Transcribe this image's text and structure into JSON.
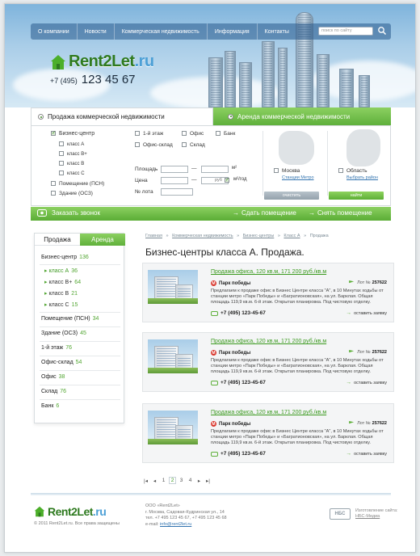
{
  "nav": {
    "items": [
      "О компании",
      "Новости",
      "Коммерческая недвижимость",
      "Информация",
      "Контакты"
    ],
    "search_placeholder": "поиск по сайту"
  },
  "brand": {
    "name_main": "Rent2Let",
    "name_tld": ".ru",
    "phone_code": "+7 (495)",
    "phone_number": "123 45 67"
  },
  "search_panel": {
    "tab_commercial": "Продажа коммерческой недвижимости",
    "tab_rent": "Аренда коммерческой недвижимости",
    "types": {
      "business_center": "Бизнес-центр",
      "class_a": "класс А",
      "class_b_plus": "класс В+",
      "class_b": "класс В",
      "class_c": "класс С",
      "premises": "Помещение (ПСН)",
      "building": "Здание (ОСЗ)"
    },
    "options": {
      "first_floor": "1-й этаж",
      "office": "Офис",
      "bank": "Банк",
      "office_warehouse": "Офис-склад",
      "warehouse": "Склад"
    },
    "area_label": "Площадь",
    "area_unit": "м²",
    "price_label": "Цена",
    "price_currency": "руб",
    "price_per": "м²/год",
    "lot_label": "№ лота",
    "dash": "—",
    "moscow": "Москва",
    "metro_stations": "Станции Метро",
    "region": "Область",
    "choose_region": "Выбрать район",
    "clear_button": "очистить",
    "find_button": "найти"
  },
  "actions": {
    "order_call": "Заказать звонок",
    "lease_out": "Сдать помещение",
    "rent_in": "Снять помещение"
  },
  "sidebar": {
    "tab_sale": "Продажа",
    "tab_rent": "Аренда",
    "items": [
      {
        "label": "Бизнес-центр",
        "count": "136"
      },
      {
        "label": "класс А",
        "count": "36"
      },
      {
        "label": "класс В+",
        "count": "64"
      },
      {
        "label": "класс В",
        "count": "21"
      },
      {
        "label": "класс С",
        "count": "15"
      },
      {
        "label": "Помещение (ПСН)",
        "count": "34"
      },
      {
        "label": "Здание (ОСЗ)",
        "count": "45"
      },
      {
        "label": "1-й этаж",
        "count": "76"
      },
      {
        "label": "Офис-склад",
        "count": "54"
      },
      {
        "label": "Офис",
        "count": "38"
      },
      {
        "label": "Склад",
        "count": "76"
      },
      {
        "label": "Банк",
        "count": "6"
      }
    ]
  },
  "breadcrumbs": [
    "Главная",
    "»",
    "Коммерческая недвижимость",
    "»",
    "Бизнес-центры",
    "»",
    "Класс А",
    "»",
    "Продажа"
  ],
  "page_title": "Бизнес-центры класса А. Продажа.",
  "listings": [
    {
      "title": "Продажа офиса, 120 кв.м, 171 200 руб./кв.м",
      "metro": "Парк победы",
      "lot_label": "Лот №",
      "lot": "257622",
      "description": "Предлагаем к продаже офис в Бизнес Центре класса \"А\", в 10 Минутах ходьбы от станции метро «Парк Победы» и «Багратионовская», на ул. Барклая. Общая площадь 119,9 кв.м. 6-й этаж. Открытая планировка. Под чистовую отделку.",
      "phone": "+7 (495) 123-45-67",
      "request": "оставить заявку"
    },
    {
      "title": "Продажа офиса, 120 кв.м, 171 200 руб./кв.м",
      "metro": "Парк победы",
      "lot_label": "Лот №",
      "lot": "257622",
      "description": "Предлагаем к продаже офис в Бизнес Центре класса \"А\", в 10 Минутах ходьбы от станции метро «Парк Победы» и «Багратионовская», на ул. Барклая. Общая площадь 119,9 кв.м. 6-й этаж. Открытая планировка. Под чистовую отделку.",
      "phone": "+7 (495) 123-45-67",
      "request": "оставить заявку"
    },
    {
      "title": "Продажа офиса, 120 кв.м, 171 200 руб./кв.м",
      "metro": "Парк победы",
      "lot_label": "Лот №",
      "lot": "257622",
      "description": "Предлагаем к продаже офис в Бизнес Центре класса \"А\", в 10 Минутах ходьбы от станции метро «Парк Победы» и «Багратионовская», на ул. Барклая. Общая площадь 119,9 кв.м. 6-й этаж. Открытая планировка. Под чистовую отделку.",
      "phone": "+7 (495) 123-45-67",
      "request": "оставить заявку"
    }
  ],
  "pager": {
    "first": "|◂",
    "prev": "◂",
    "pages": [
      "1",
      "2",
      "3",
      "4"
    ],
    "current": "2",
    "next": "▸",
    "last": "▸|"
  },
  "footer": {
    "copyright": "© 2011 Rent2Let.ru. Все права защищены",
    "company": "ООО «Rent2Let»",
    "address": "г. Москва, Садовая-Кудринская ул., 14",
    "phones": "тел. +7 495 123 45 67, +7 495 123 45 68",
    "email_label": "e-mail:",
    "email": "info@rent2let.ru",
    "dev_logo": "НБС",
    "dev_line1": "Изготовление сайта:",
    "dev_line2": "НБС-Медиа"
  },
  "colors": {
    "green": "#5fb03b",
    "blue_link": "#3475b0",
    "sky": "#a9cde8"
  }
}
